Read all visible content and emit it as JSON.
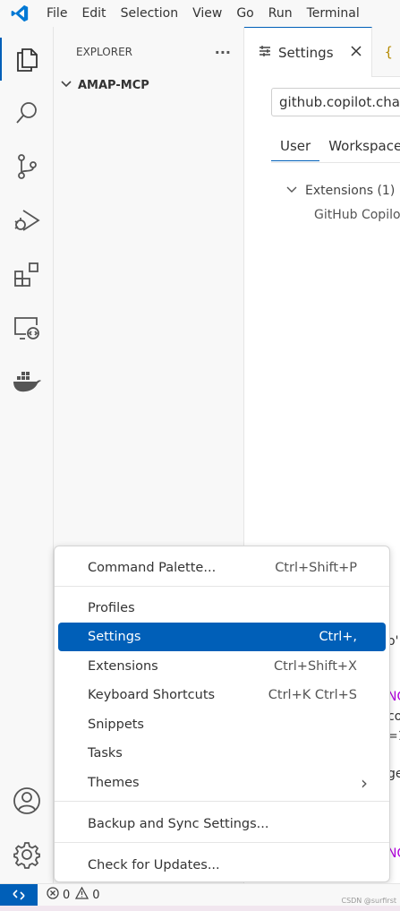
{
  "titlebar": {
    "menu": [
      "File",
      "Edit",
      "Selection",
      "View",
      "Go",
      "Run",
      "Terminal"
    ]
  },
  "activity_icons": [
    "explorer-icon",
    "search-icon",
    "source-control-icon",
    "run-debug-icon",
    "extensions-icon",
    "remote-explorer-icon",
    "docker-icon",
    "account-icon",
    "manage-gear-icon"
  ],
  "explorer": {
    "title": "EXPLORER",
    "more": "···",
    "folder": "AMAP-MCP"
  },
  "editor": {
    "tab_label": "Settings",
    "tab2_glyph": "{",
    "search_value": "github.copilot.chat.",
    "scope_tabs": [
      "User",
      "Workspace"
    ],
    "tree_group": "Extensions (1)",
    "tree_item": "GitHub Copilot",
    "fragments": [
      "o'",
      "NG",
      "co",
      "=1",
      "ge",
      "NG"
    ]
  },
  "menu": {
    "command_palette": {
      "label": "Command Palette...",
      "shortcut": "Ctrl+Shift+P"
    },
    "profiles": {
      "label": "Profiles"
    },
    "settings": {
      "label": "Settings",
      "shortcut": "Ctrl+,"
    },
    "extensions": {
      "label": "Extensions",
      "shortcut": "Ctrl+Shift+X"
    },
    "keyboard_shortcuts": {
      "label": "Keyboard Shortcuts",
      "shortcut": "Ctrl+K Ctrl+S"
    },
    "snippets": {
      "label": "Snippets"
    },
    "tasks": {
      "label": "Tasks"
    },
    "themes": {
      "label": "Themes",
      "submenu": "›"
    },
    "backup_sync": {
      "label": "Backup and Sync Settings..."
    },
    "check_updates": {
      "label": "Check for Updates..."
    }
  },
  "statusbar": {
    "errors": "0",
    "warnings": "0"
  },
  "watermark": "CSDN @surfirst",
  "colors": {
    "accent": "#005fb8",
    "vscode_logo": "#0078d4"
  }
}
